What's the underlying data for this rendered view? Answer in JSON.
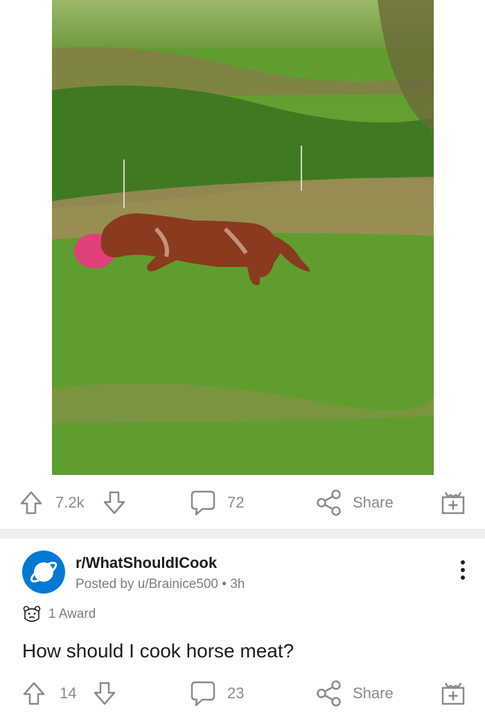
{
  "post1": {
    "upvotes": "7.2k",
    "comments": "72",
    "share_label": "Share"
  },
  "post2": {
    "subreddit": "r/WhatShouldICook",
    "posted_by": "Posted by u/Brainice500",
    "age": "3h",
    "award": "1 Award",
    "title": "How should I cook horse meat?",
    "upvotes": "14",
    "comments": "23",
    "share_label": "Share"
  },
  "icons": [
    "upvote-icon",
    "downvote-icon",
    "comment-icon",
    "share-icon",
    "gift-award-icon",
    "planet-icon",
    "award-bear-icon",
    "overflow-menu-icon"
  ],
  "colors": {
    "subreddit_avatar": "#0079d3",
    "action_gray": "#878a8c",
    "divider": "#edeff1"
  }
}
